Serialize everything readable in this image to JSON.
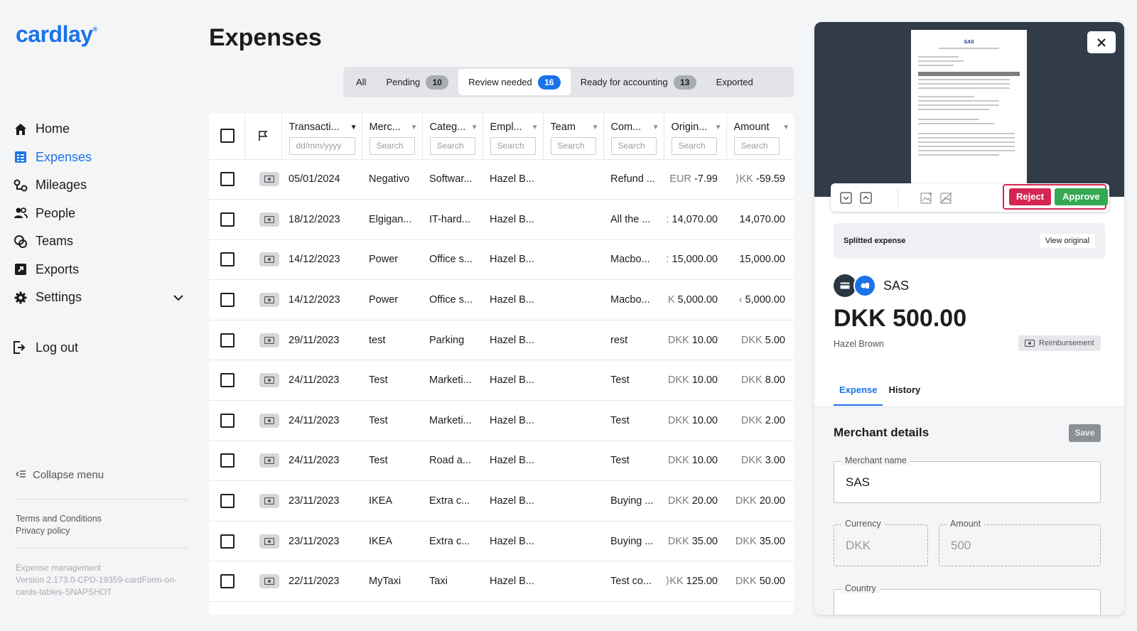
{
  "app": {
    "logo": "cardlay",
    "logo_mark": "®"
  },
  "sidebar": {
    "items": [
      {
        "label": "Home",
        "icon": "home-icon"
      },
      {
        "label": "Expenses",
        "icon": "expenses-icon",
        "active": true
      },
      {
        "label": "Mileages",
        "icon": "mileages-icon"
      },
      {
        "label": "People",
        "icon": "people-icon"
      },
      {
        "label": "Teams",
        "icon": "teams-icon"
      },
      {
        "label": "Exports",
        "icon": "exports-icon"
      },
      {
        "label": "Settings",
        "icon": "gear-icon"
      }
    ],
    "logout": "Log out",
    "collapse": "Collapse menu",
    "terms": "Terms and Conditions",
    "privacy": "Privacy policy",
    "version_line1": "Expense management",
    "version_line2": "Version 2.173.0-CPD-19359-cardForm-on-cards-tables-SNAPSHOT"
  },
  "main": {
    "title": "Expenses",
    "tabs": [
      {
        "label": "All",
        "count": null
      },
      {
        "label": "Pending",
        "count": "10"
      },
      {
        "label": "Review needed",
        "count": "16",
        "active": true
      },
      {
        "label": "Ready for accounting",
        "count": "13"
      },
      {
        "label": "Exported",
        "count": null
      }
    ],
    "columns": {
      "transaction": "Transacti...",
      "merchant": "Merc...",
      "category": "Categ...",
      "employee": "Empl...",
      "team": "Team",
      "comment": "Com...",
      "original": "Origin...",
      "amount": "Amount"
    },
    "date_placeholder": "dd/mm/yyyy",
    "search_placeholder": "Search",
    "rows": [
      {
        "date": "05/01/2024",
        "merchant": "Negativo",
        "category": "Softwar...",
        "employee": "Hazel B...",
        "team": "",
        "comment": "Refund ...",
        "orig_cur": "EUR",
        "orig_val": "-7.99",
        "amt_cur": "⟩KK",
        "amt_val": "-59.59"
      },
      {
        "date": "18/12/2023",
        "merchant": "Elgigan...",
        "category": "IT-hard...",
        "employee": "Hazel B...",
        "team": "",
        "comment": "All the ...",
        "orig_cur": ":",
        "orig_val": "14,070.00",
        "amt_cur": "",
        "amt_val": "14,070.00"
      },
      {
        "date": "14/12/2023",
        "merchant": "Power",
        "category": "Office s...",
        "employee": "Hazel B...",
        "team": "",
        "comment": "Macbo...",
        "orig_cur": ":",
        "orig_val": "15,000.00",
        "amt_cur": "",
        "amt_val": "15,000.00"
      },
      {
        "date": "14/12/2023",
        "merchant": "Power",
        "category": "Office s...",
        "employee": "Hazel B...",
        "team": "",
        "comment": "Macbo...",
        "orig_cur": "K",
        "orig_val": "5,000.00",
        "amt_cur": "‹",
        "amt_val": "5,000.00"
      },
      {
        "date": "29/11/2023",
        "merchant": "test",
        "category": "Parking",
        "employee": "Hazel B...",
        "team": "",
        "comment": "rest",
        "orig_cur": "DKK",
        "orig_val": "10.00",
        "amt_cur": "DKK",
        "amt_val": "5.00"
      },
      {
        "date": "24/11/2023",
        "merchant": "Test",
        "category": "Marketi...",
        "employee": "Hazel B...",
        "team": "",
        "comment": "Test",
        "orig_cur": "DKK",
        "orig_val": "10.00",
        "amt_cur": "DKK",
        "amt_val": "8.00"
      },
      {
        "date": "24/11/2023",
        "merchant": "Test",
        "category": "Marketi...",
        "employee": "Hazel B...",
        "team": "",
        "comment": "Test",
        "orig_cur": "DKK",
        "orig_val": "10.00",
        "amt_cur": "DKK",
        "amt_val": "2.00"
      },
      {
        "date": "24/11/2023",
        "merchant": "Test",
        "category": "Road a...",
        "employee": "Hazel B...",
        "team": "",
        "comment": "Test",
        "orig_cur": "DKK",
        "orig_val": "10.00",
        "amt_cur": "DKK",
        "amt_val": "3.00"
      },
      {
        "date": "23/11/2023",
        "merchant": "IKEA",
        "category": "Extra c...",
        "employee": "Hazel B...",
        "team": "",
        "comment": "Buying ...",
        "orig_cur": "DKK",
        "orig_val": "20.00",
        "amt_cur": "DKK",
        "amt_val": "20.00"
      },
      {
        "date": "23/11/2023",
        "merchant": "IKEA",
        "category": "Extra c...",
        "employee": "Hazel B...",
        "team": "",
        "comment": "Buying ...",
        "orig_cur": "DKK",
        "orig_val": "35.00",
        "amt_cur": "DKK",
        "amt_val": "35.00"
      },
      {
        "date": "22/11/2023",
        "merchant": "MyTaxi",
        "category": "Taxi",
        "employee": "Hazel B...",
        "team": "",
        "comment": "Test co...",
        "orig_cur": "⟩KK",
        "orig_val": "125.00",
        "amt_cur": "DKK",
        "amt_val": "50.00"
      }
    ]
  },
  "panel": {
    "receipt_brand": "SAS",
    "reject": "Reject",
    "approve": "Approve",
    "split_label": "Splitted expense",
    "view_original": "View original",
    "merchant": "SAS",
    "amount": "DKK 500.00",
    "employee": "Hazel Brown",
    "reimbursement": "Reimbursement",
    "tabs": [
      "Expense",
      "History"
    ],
    "section_title": "Merchant details",
    "save": "Save",
    "merchant_name_label": "Merchant name",
    "merchant_name_value": "SAS",
    "currency_label": "Currency",
    "currency_value": "DKK",
    "amount_label": "Amount",
    "amount_value": "500",
    "country_label": "Country"
  },
  "colors": {
    "accent": "#1a73e8",
    "reject": "#d62553",
    "approve": "#34a853",
    "preview_bg": "#323c48"
  }
}
